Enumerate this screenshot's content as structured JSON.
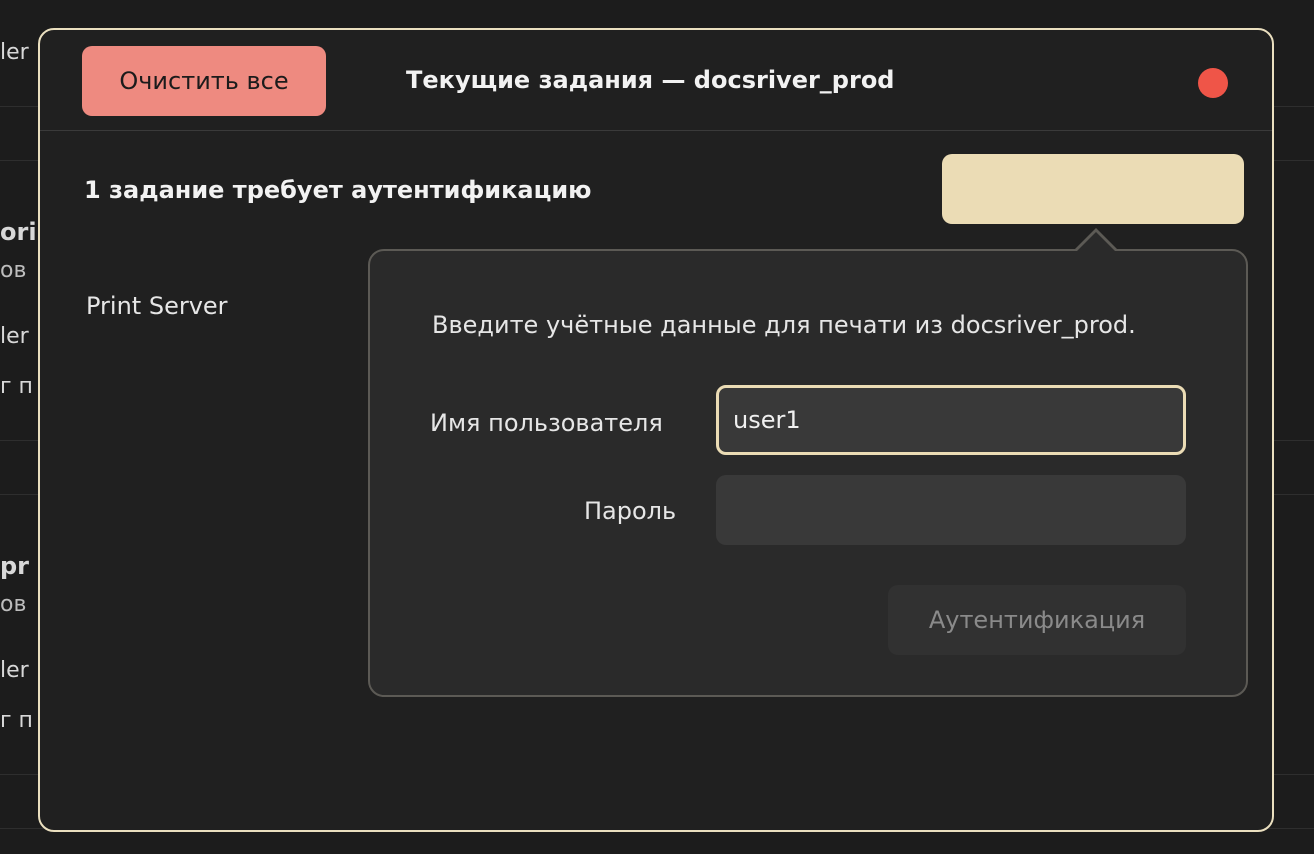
{
  "background": {
    "fragments": [
      {
        "text": "ler",
        "style": "normal"
      },
      {
        "text": "ori",
        "style": "bold"
      },
      {
        "text": "ов",
        "style": "dim"
      },
      {
        "text": "ler",
        "style": "normal"
      },
      {
        "text": "г п",
        "style": "normal"
      },
      {
        "text": "pr",
        "style": "bold"
      },
      {
        "text": "ов",
        "style": "dim"
      },
      {
        "text": "ler",
        "style": "normal"
      },
      {
        "text": "г п",
        "style": "normal"
      }
    ]
  },
  "dialog": {
    "clear_all_label": "Очистить все",
    "title": "Текущие задания — docsriver_prod",
    "auth_notice": "1 задание требует аутентификацию",
    "server_label": "Print Server"
  },
  "popover": {
    "prompt": "Введите учётные данные для печати из docsriver_prod.",
    "username_label": "Имя пользователя",
    "username_value": "user1",
    "password_label": "Пароль",
    "password_value": "",
    "auth_button_label": "Аутентификация"
  },
  "colors": {
    "accent": "#ebdcb5",
    "destructive": "#ee8a80",
    "close": "#ef5548",
    "background": "#1c1c1c",
    "dialog_bg": "#202020",
    "popover_bg": "#2a2a2a"
  }
}
